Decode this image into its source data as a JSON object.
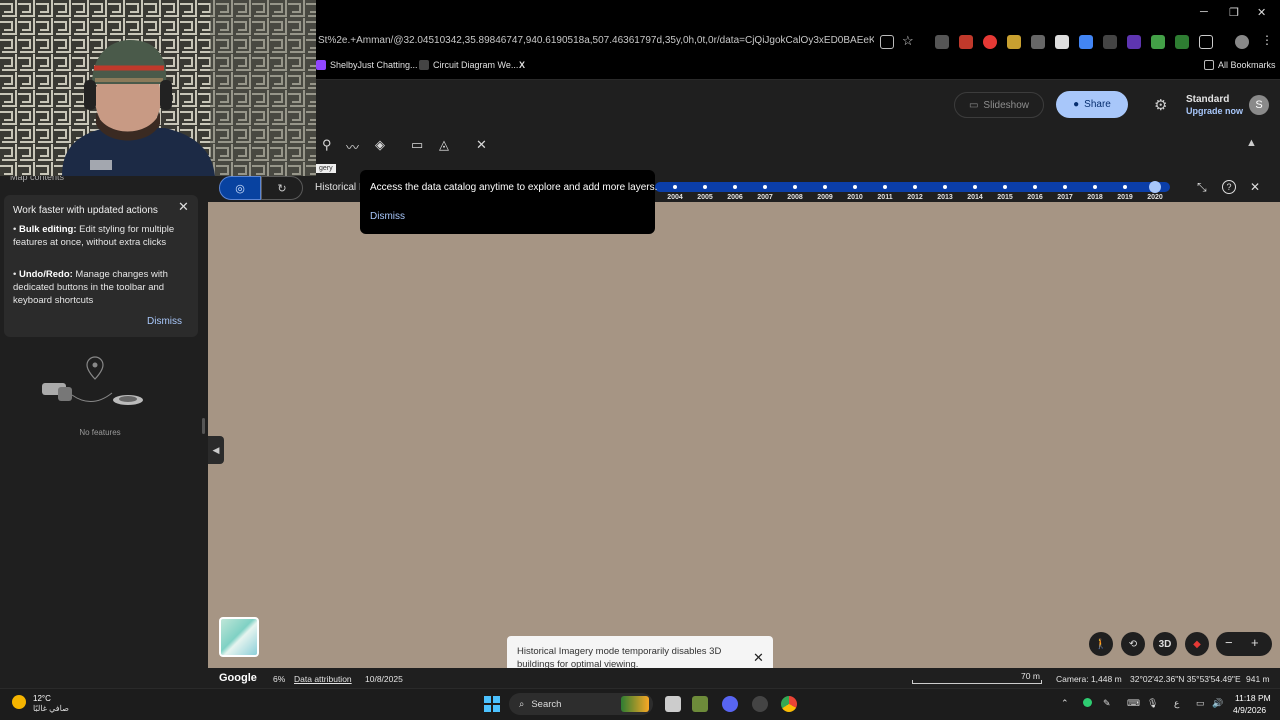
{
  "browser": {
    "url": "St%2e.+Amman/@32.04510342,35.89846747,940.6190518a,507.46361797d,35y,0h,0t,0r/data=CjQiJgokCalOy3xED0BAEeKlS6ptwT9A...",
    "bookmarks": [
      {
        "label": "ShelbyJust Chatting..."
      },
      {
        "label": "Circuit Diagram We..."
      },
      {
        "label": "X"
      }
    ],
    "all_bookmarks": "All Bookmarks",
    "window_controls": {
      "minimize": "─",
      "restore": "❐",
      "close": "✕"
    }
  },
  "earth": {
    "slideshow_label": "Slideshow",
    "share_label": "Share",
    "plan_title": "Standard",
    "plan_upgrade": "Upgrade now",
    "avatar_letter": "S",
    "small_tooltip": "gery",
    "historical_label": "Historical I",
    "catalog_tip": {
      "text": "Access the data catalog anytime to explore and add more layers.",
      "dismiss": "Dismiss"
    },
    "timeline_years": [
      "2004",
      "2005",
      "2006",
      "2007",
      "2008",
      "2009",
      "2010",
      "2011",
      "2012",
      "2013",
      "2014",
      "2015",
      "2016",
      "2017",
      "2018",
      "2019",
      "2020"
    ],
    "timeline_selected_fraction": 0.97
  },
  "panel": {
    "header": "Map contents",
    "info_card": {
      "title": "Work faster with updated actions",
      "bulk_bold": "Bulk editing:",
      "bulk_text": " Edit styling for multiple features at once, without extra clicks",
      "undo_bold": "Undo/Redo:",
      "undo_text": " Manage changes with dedicated buttons in the toolbar and keyboard shortcuts",
      "dismiss": "Dismiss"
    },
    "empty_state": "No features"
  },
  "map": {
    "controls": {
      "threed": "3D"
    },
    "toast": "Historical Imagery mode temporarily disables 3D buildings for optimal viewing.",
    "status": {
      "logo": "Google",
      "percent": "6%",
      "attribution": "Data attribution",
      "date": "10/8/2025",
      "scale": "70 m",
      "camera": "Camera: 1,448 m",
      "coords": "32°02'42.36\"N 35°53'54.49\"E",
      "elevation": "941 m"
    }
  },
  "taskbar": {
    "weather_temp": "12°C",
    "weather_desc": "صافي غالبًا",
    "search": "Search",
    "time": "11:18 PM",
    "date": "4/9/2026",
    "lang": "ع"
  },
  "colors": {
    "accent": "#a8c7fa",
    "timeline": "#0b3ea8",
    "map": "#a69584"
  }
}
